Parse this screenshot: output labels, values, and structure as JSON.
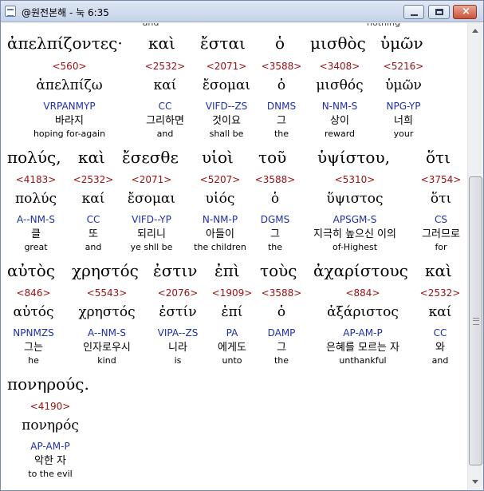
{
  "window": {
    "title": "@원전본해 - 눅 6:35"
  },
  "cut_top_row": [
    "",
    "and",
    "",
    "",
    "",
    "nothing"
  ],
  "lines": [
    {
      "words": [
        {
          "greek": "ἀπελπίζοντες·",
          "strongs": "<560>",
          "lemma": "ἀπελπίζω",
          "parse": "VRPANMYP",
          "korean": "바라지",
          "english": "hoping for-again"
        },
        {
          "greek": "καὶ",
          "strongs": "<2532>",
          "lemma": "καί",
          "parse": "CC",
          "korean": "그리하면",
          "english": "and"
        },
        {
          "greek": "ἔσται",
          "strongs": "<2071>",
          "lemma": "ἔσομαι",
          "parse": "VIFD--ZS",
          "korean": "것이요",
          "english": "shall be"
        },
        {
          "greek": "ὁ",
          "strongs": "<3588>",
          "lemma": "ὁ",
          "parse": "DNMS",
          "korean": "그",
          "english": "the"
        },
        {
          "greek": "μισθὸς",
          "strongs": "<3408>",
          "lemma": "μισθός",
          "parse": "N-NM-S",
          "korean": "상이",
          "english": "reward"
        },
        {
          "greek": "ὑμῶν",
          "strongs": "<5216>",
          "lemma": "ὑμῶν",
          "parse": "NPG-YP",
          "korean": "너희",
          "english": "your"
        }
      ]
    },
    {
      "words": [
        {
          "greek": "πολύς,",
          "strongs": "<4183>",
          "lemma": "πολύς",
          "parse": "A--NM-S",
          "korean": "클",
          "english": "great"
        },
        {
          "greek": "καὶ",
          "strongs": "<2532>",
          "lemma": "καί",
          "parse": "CC",
          "korean": "또",
          "english": "and"
        },
        {
          "greek": "ἔσεσθε",
          "strongs": "<2071>",
          "lemma": "ἔσομαι",
          "parse": "VIFD--YP",
          "korean": "되리니",
          "english": "ye shll be"
        },
        {
          "greek": "υἱοὶ",
          "strongs": "<5207>",
          "lemma": "υἱός",
          "parse": "N-NM-P",
          "korean": "아들이",
          "english": "the children"
        },
        {
          "greek": "τοῦ",
          "strongs": "<3588>",
          "lemma": "ὁ",
          "parse": "DGMS",
          "korean": "그",
          "english": "the"
        },
        {
          "greek": "ὑψίστου,",
          "strongs": "<5310>",
          "lemma": "ὕψιστος",
          "parse": "APSGM-S",
          "korean": "지극히 높으신 이의",
          "english": "of-Highest"
        },
        {
          "greek": "ὅτι",
          "strongs": "<3754>",
          "lemma": "ὅτι",
          "parse": "CS",
          "korean": "그러므로",
          "english": "for"
        }
      ]
    },
    {
      "words": [
        {
          "greek": "αὐτὸς",
          "strongs": "<846>",
          "lemma": "αὐτός",
          "parse": "NPNMZS",
          "korean": "그는",
          "english": "he"
        },
        {
          "greek": "χρηστός",
          "strongs": "<5543>",
          "lemma": "χρηστός",
          "parse": "A--NM-S",
          "korean": "인자로우시",
          "english": "kind"
        },
        {
          "greek": "ἐστιν",
          "strongs": "<2076>",
          "lemma": "ἐστίν",
          "parse": "VIPA--ZS",
          "korean": "니라",
          "english": "is"
        },
        {
          "greek": "ἐπὶ",
          "strongs": "<1909>",
          "lemma": "ἐπί",
          "parse": "PA",
          "korean": "에게도",
          "english": "unto"
        },
        {
          "greek": "τοὺς",
          "strongs": "<3588>",
          "lemma": "ὁ",
          "parse": "DAMP",
          "korean": "그",
          "english": "the"
        },
        {
          "greek": "ἀχαρίστους",
          "strongs": "<884>",
          "lemma": "ἀξάριστος",
          "parse": "AP-AM-P",
          "korean": "은혜를 모르는 자",
          "english": "unthankful"
        },
        {
          "greek": "καὶ",
          "strongs": "<2532>",
          "lemma": "καί",
          "parse": "CC",
          "korean": "와",
          "english": "and"
        }
      ]
    },
    {
      "words": [
        {
          "greek": "πονηρούς.",
          "strongs": "<4190>",
          "lemma": "πονηρός",
          "parse": "AP-AM-P",
          "korean": "악한 자",
          "english": "to the evil"
        }
      ]
    }
  ]
}
